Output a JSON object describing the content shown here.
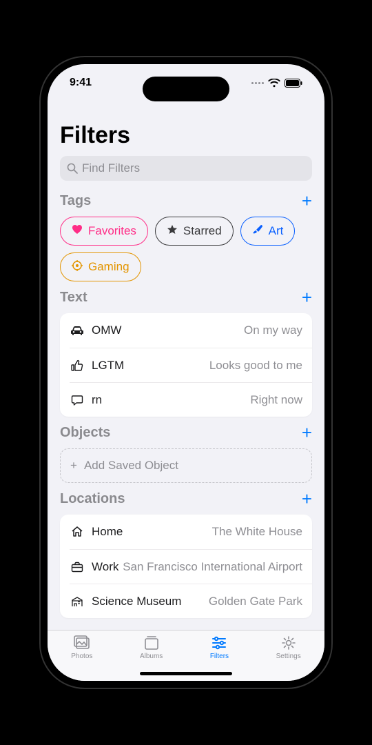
{
  "status": {
    "time": "9:41"
  },
  "page": {
    "title": "Filters"
  },
  "search": {
    "placeholder": "Find Filters"
  },
  "sections": {
    "tags": {
      "title": "Tags",
      "chips": [
        {
          "label": "Favorites"
        },
        {
          "label": "Starred"
        },
        {
          "label": "Art"
        },
        {
          "label": "Gaming"
        }
      ]
    },
    "text": {
      "title": "Text",
      "rows": [
        {
          "key": "OMW",
          "val": "On my way"
        },
        {
          "key": "LGTM",
          "val": "Looks good to me"
        },
        {
          "key": "rn",
          "val": "Right now"
        }
      ]
    },
    "objects": {
      "title": "Objects",
      "placeholder": "Add Saved Object"
    },
    "locations": {
      "title": "Locations",
      "rows": [
        {
          "key": "Home",
          "val": "The White House"
        },
        {
          "key": "Work",
          "val": "San Francisco International Airport"
        },
        {
          "key": "Science Museum",
          "val": "Golden Gate Park"
        }
      ]
    }
  },
  "tabs": {
    "photos": "Photos",
    "albums": "Albums",
    "filters": "Filters",
    "settings": "Settings"
  }
}
